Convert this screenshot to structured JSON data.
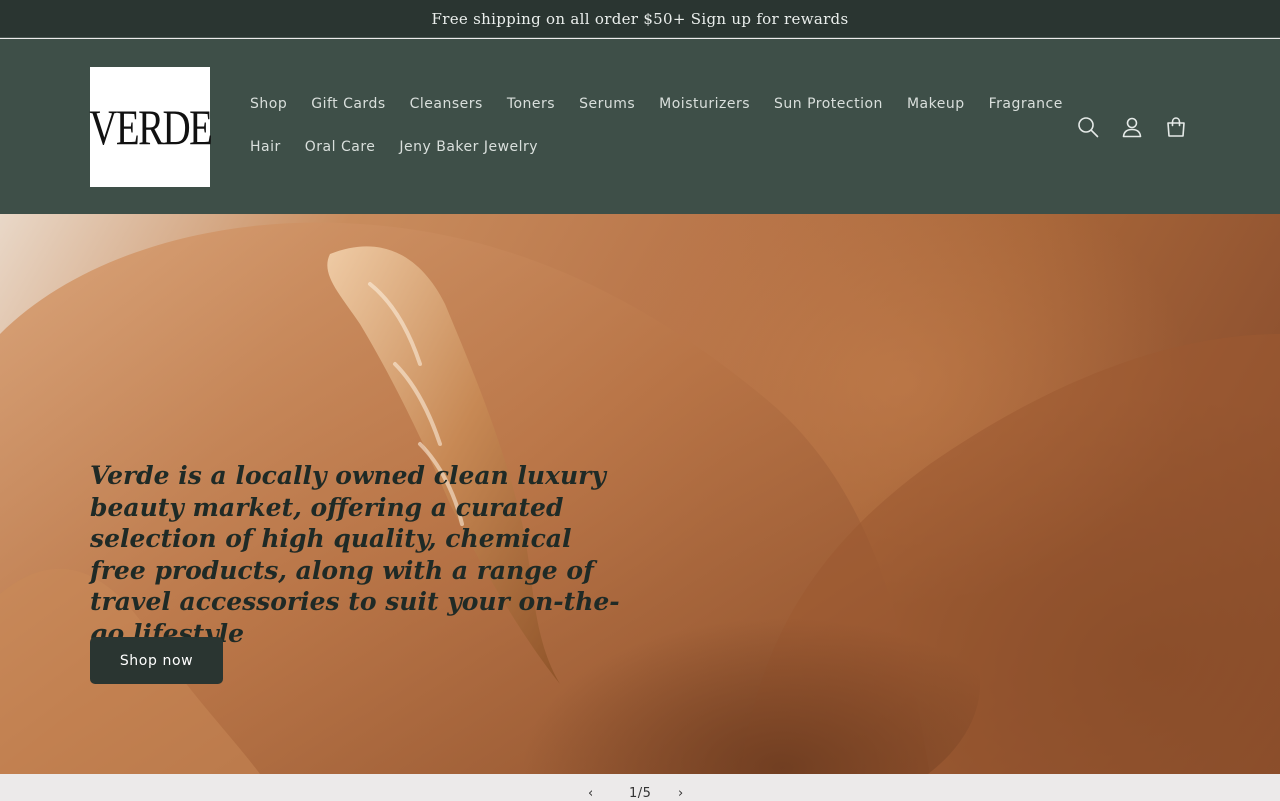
{
  "announcement": {
    "text": "Free shipping on all order $50+ Sign up for rewards"
  },
  "header": {
    "logo_text": "VERDE",
    "nav": {
      "row1": [
        "Shop",
        "Gift Cards",
        "Cleansers",
        "Toners",
        "Serums",
        "Moisturizers",
        "Sun Protection",
        "Makeup",
        "Fragrance"
      ],
      "row2": [
        "Hair",
        "Oral Care",
        "Jeny Baker Jewelry"
      ]
    },
    "icons": [
      "search-icon",
      "account-icon",
      "cart-icon"
    ]
  },
  "hero": {
    "heading": "Verde is a locally owned clean luxury beauty market, offering a curated selection of high quality, chemical free products, along with a range of travel accessories to suit your on-the-go lifestyle",
    "cta_label": "Shop now"
  },
  "slider": {
    "prev": "‹",
    "counter": "1/5",
    "next": "›"
  },
  "colors": {
    "announcement_bg": "#2a3531",
    "header_bg": "#3e4f48",
    "button_bg": "#2a3531"
  }
}
